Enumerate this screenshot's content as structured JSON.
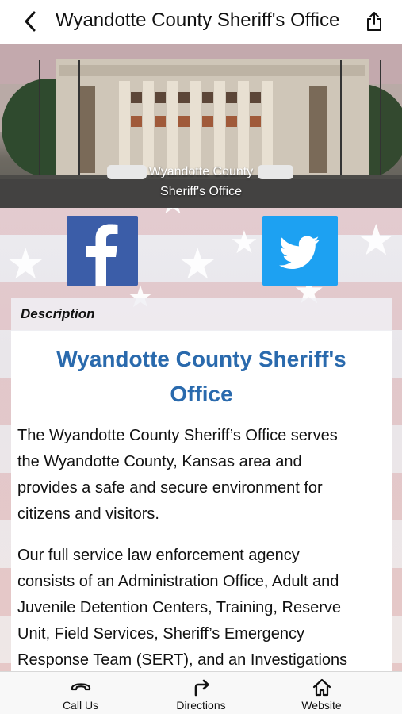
{
  "header": {
    "title": "Wyandotte County Sheriff's Office",
    "back_icon": "chevron-left-icon",
    "share_icon": "share-icon"
  },
  "hero": {
    "caption_line1": "Wyandotte County",
    "caption_line2": "Sheriff's Office"
  },
  "social": {
    "facebook_icon": "facebook-icon",
    "facebook_color": "#3b5da8",
    "twitter_icon": "twitter-icon",
    "twitter_color": "#1da1f2"
  },
  "description": {
    "label": "Description",
    "title_line1": "Wyandotte County Sheriff's",
    "title_line2": "Office",
    "title_color": "#2a6aad",
    "para1_lines": [
      "The Wyandotte County Sheriff’s Office serves",
      "the Wyandotte County, Kansas area and",
      "provides a safe and secure environment for",
      "citizens and visitors."
    ],
    "para2_lines": [
      "Our full service law enforcement agency",
      "consists of an Administration Office, Adult and",
      "Juvenile Detention Centers, Training, Reserve",
      "Unit, Field Services, Sheriff’s Emergency",
      "Response Team (SERT), and an Investigations"
    ]
  },
  "tabbar": {
    "items": [
      {
        "label": "Call Us",
        "icon": "phone-icon"
      },
      {
        "label": "Directions",
        "icon": "directions-icon"
      },
      {
        "label": "Website",
        "icon": "home-icon"
      }
    ]
  }
}
